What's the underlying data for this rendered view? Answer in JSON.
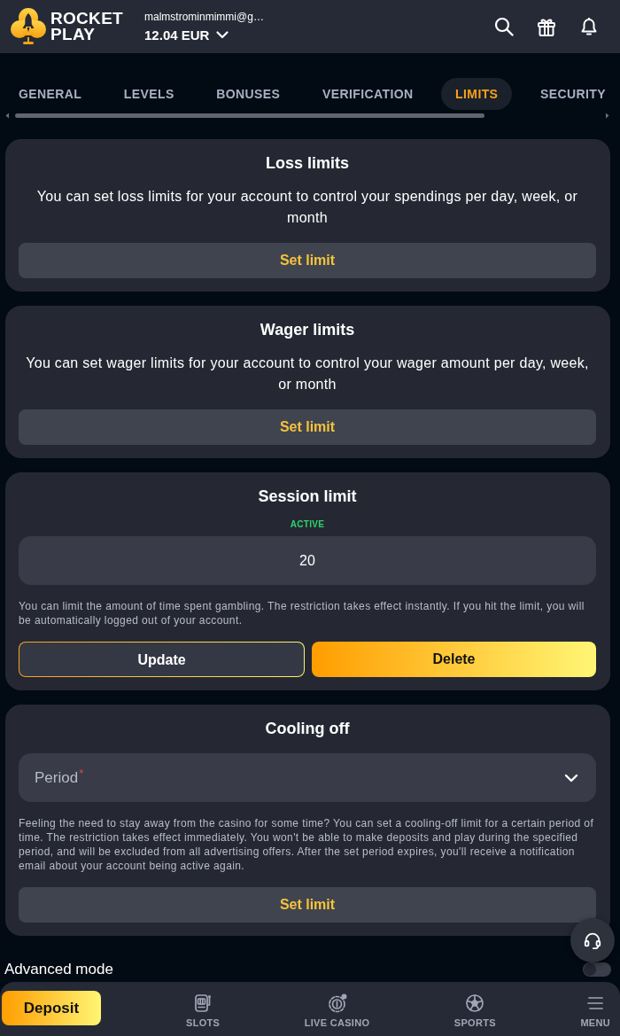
{
  "header": {
    "logo_lines": [
      "ROCKET",
      "PLAY"
    ],
    "email": "malmstrominmimmi@g…",
    "balance": "12.04 EUR"
  },
  "tabs": [
    {
      "label": "GENERAL",
      "selected": false
    },
    {
      "label": "LEVELS",
      "selected": false
    },
    {
      "label": "BONUSES",
      "selected": false
    },
    {
      "label": "VERIFICATION",
      "selected": false
    },
    {
      "label": "LIMITS",
      "selected": true
    },
    {
      "label": "SECURITY",
      "selected": false
    }
  ],
  "cards": [
    {
      "kind": "simple",
      "title": "Loss limits",
      "description": "You can set loss limits for your account to control your spendings per day, week, or month",
      "button": "Set limit"
    },
    {
      "kind": "simple",
      "title": "Wager limits",
      "description": "You can set wager limits for your account to control your wager amount per day, week, or month",
      "button": "Set limit"
    },
    {
      "kind": "session",
      "title": "Session limit",
      "status": "ACTIVE",
      "value": "20",
      "note": "You can limit the amount of time spent gambling. The restriction takes effect instantly. If you hit the limit, you will be automatically logged out of your account.",
      "buttons": [
        {
          "label": "Update",
          "kind": "outline"
        },
        {
          "label": "Delete",
          "kind": "filled"
        }
      ]
    },
    {
      "kind": "cooling",
      "title": "Cooling off",
      "select": {
        "placeholder": "Period",
        "required_mark": "*"
      },
      "note": "Feeling the need to stay away from the casino for some time? You can set a cooling-off limit for a certain period of time. The restriction takes effect immediately. You won't be able to make deposits and play during the specified period, and will be excluded from all advertising offers. After the set period expires, you'll receive a notification email about your account being active again.",
      "button": "Set limit"
    }
  ],
  "advanced_mode": {
    "label": "Advanced mode",
    "on": false
  },
  "bottom_nav": {
    "deposit": "Deposit",
    "items": [
      {
        "label": "SLOTS",
        "selected": false
      },
      {
        "label": "LIVE CASINO",
        "selected": false
      },
      {
        "label": "SPORTS",
        "selected": false
      },
      {
        "label": "MENU",
        "selected": false
      }
    ]
  }
}
